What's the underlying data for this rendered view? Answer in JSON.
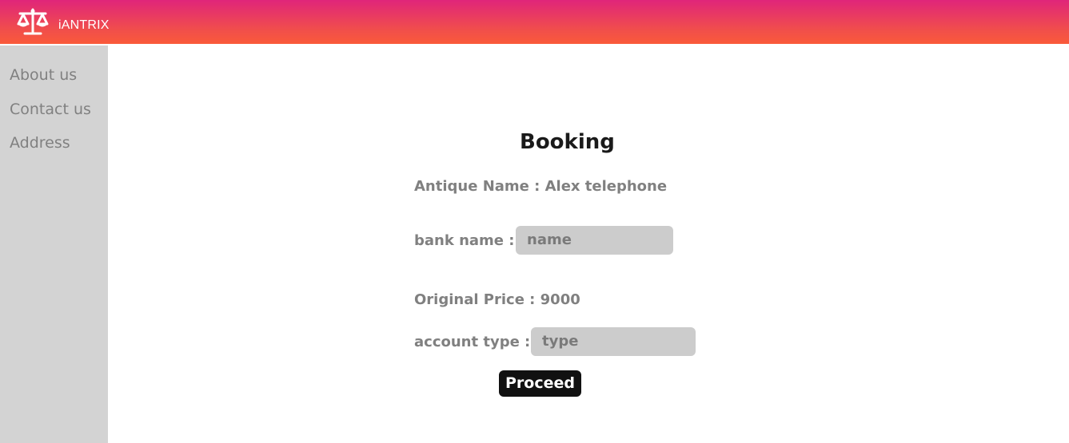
{
  "header": {
    "brand_name": "iANTRIX",
    "logo_icon": "scales-icon",
    "gradient": [
      "#e0257a",
      "#fa5a3a"
    ]
  },
  "sidebar": {
    "items": [
      {
        "label": "About us"
      },
      {
        "label": "Contact us"
      },
      {
        "label": "Address"
      }
    ]
  },
  "booking": {
    "title": "Booking",
    "antique_name_text": "Antique Name : Alex telephone",
    "bank_name_label": "bank name :",
    "bank_name_placeholder": "name",
    "original_price_text": "Original Price : 9000",
    "account_type_label": "account type :",
    "account_type_placeholder": "type",
    "proceed_label": "Proceed"
  }
}
